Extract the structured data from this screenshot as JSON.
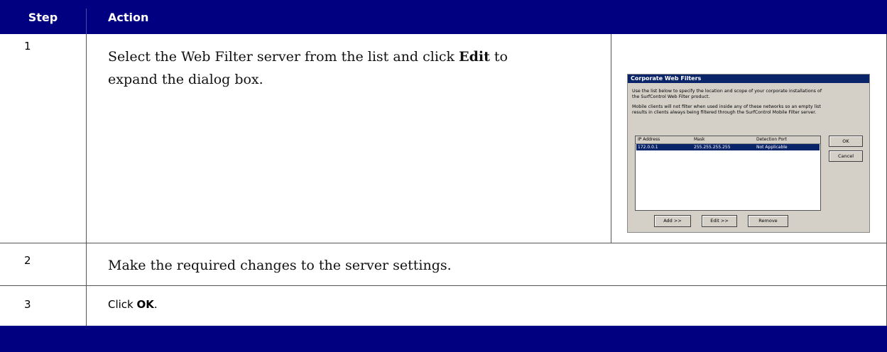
{
  "header": {
    "step_label": "Step",
    "action_label": "Action"
  },
  "rows": [
    {
      "step": "1",
      "text_line1": "Select the Web Filter server from the list and click ",
      "bold": "Edit",
      "text_line1_end": " to",
      "text_line2": "expand the dialog box."
    },
    {
      "step": "2",
      "text": "Make the required changes to the server settings."
    },
    {
      "step": "3",
      "text_prefix": "Click ",
      "bold": "OK",
      "text_suffix": "."
    }
  ],
  "dialog": {
    "title": "Corporate Web Filters",
    "para1_line1": "Use the list below to specify the location and scope of your corporate installations of",
    "para1_line2": "the SurfControl Web Filter product.",
    "para2_line1": "Mobile clients will not filter when used inside any of these networks so an empty list",
    "para2_line2": "results in clients always being filtered through the SurfControl Mobile Filter server.",
    "columns": [
      "IP Address",
      "Mask",
      "Detection Port"
    ],
    "row": [
      "172.0.0.1",
      "255.255.255.255",
      "Not Applicable"
    ],
    "buttons": {
      "ok": "OK",
      "cancel": "Cancel",
      "add": "Add >>",
      "edit": "Edit >>",
      "remove": "Remove"
    }
  }
}
